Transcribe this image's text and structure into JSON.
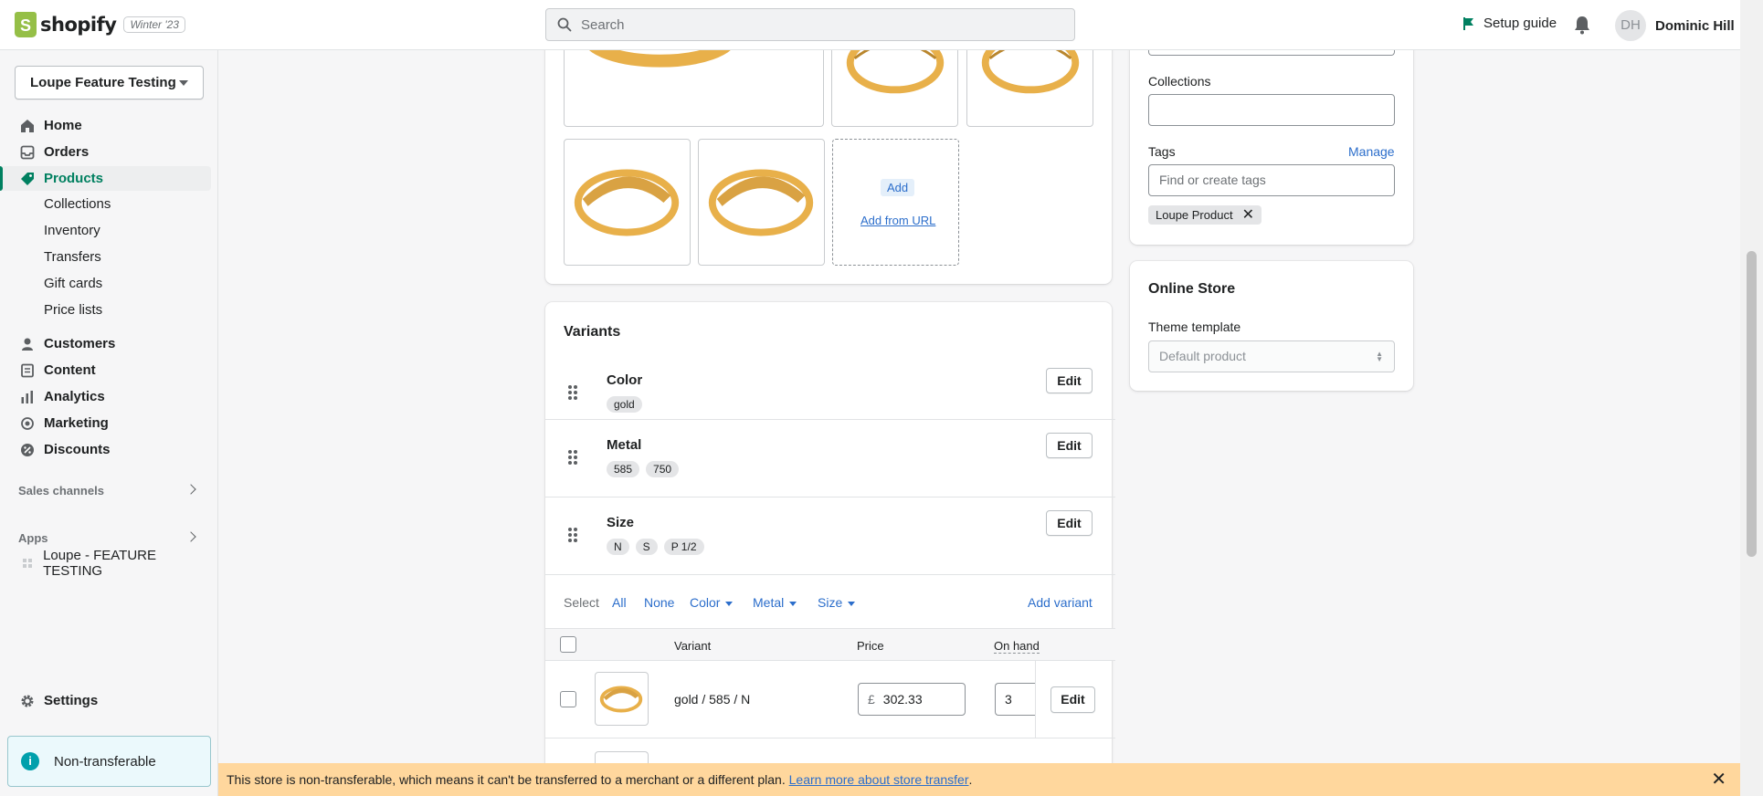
{
  "topbar": {
    "logo_glyph": "S",
    "logo_text": "shopify",
    "badge": "Winter '23",
    "search_placeholder": "Search",
    "setup_guide": "Setup guide",
    "avatar_initials": "DH",
    "user_name": "Dominic Hill"
  },
  "sidebar": {
    "store": "Loupe Feature Testing",
    "items": [
      {
        "label": "Home",
        "icon": "home-icon"
      },
      {
        "label": "Orders",
        "icon": "orders-icon"
      },
      {
        "label": "Products",
        "icon": "tag-icon"
      },
      {
        "label": "Customers",
        "icon": "person-icon"
      },
      {
        "label": "Content",
        "icon": "document-icon"
      },
      {
        "label": "Analytics",
        "icon": "bar-chart-icon"
      },
      {
        "label": "Marketing",
        "icon": "target-icon"
      },
      {
        "label": "Discounts",
        "icon": "discount-icon"
      }
    ],
    "product_sub": [
      "Collections",
      "Inventory",
      "Transfers",
      "Gift cards",
      "Price lists"
    ],
    "sales_channels": "Sales channels",
    "apps": "Apps",
    "app_item": "Loupe - FEATURE TESTING",
    "settings": "Settings",
    "non_transferable": "Non-transferable",
    "info_glyph": "i"
  },
  "media": {
    "add": "Add",
    "add_from_url": "Add from URL"
  },
  "variants": {
    "title": "Variants",
    "options": [
      {
        "name": "Color",
        "values": [
          "gold"
        ]
      },
      {
        "name": "Metal",
        "values": [
          "585",
          "750"
        ]
      },
      {
        "name": "Size",
        "values": [
          "N",
          "S",
          "P 1/2"
        ]
      }
    ],
    "edit": "Edit",
    "select_label": "Select",
    "select_all": "All",
    "select_none": "None",
    "filter_color": "Color",
    "filter_metal": "Metal",
    "filter_size": "Size",
    "add_variant": "Add variant",
    "col_variant": "Variant",
    "col_price": "Price",
    "col_on_hand": "On hand",
    "rows": [
      {
        "name": "gold / 585 / N",
        "currency": "£",
        "price": "302.33",
        "on_hand": "3"
      }
    ]
  },
  "organization": {
    "collections_label": "Collections",
    "tags_label": "Tags",
    "manage": "Manage",
    "tags_placeholder": "Find or create tags",
    "tag": "Loupe Product",
    "tag_remove": "✕"
  },
  "online_store": {
    "title": "Online Store",
    "theme_label": "Theme template",
    "theme_value": "Default product"
  },
  "banner": {
    "text": "This store is non-transferable, which means it can't be transferred to a merchant or a different plan.",
    "link": "Learn more about store transfer",
    "end": ".",
    "close": "✕"
  },
  "colors": {
    "brand_green": "#008060",
    "link_blue": "#2c6ecb",
    "banner_bg": "#ffd79d",
    "ring_gold": "#e8b04a"
  }
}
